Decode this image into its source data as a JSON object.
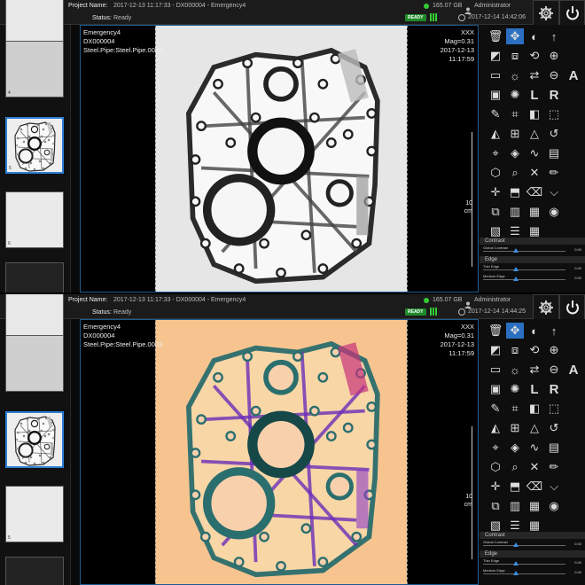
{
  "panels": [
    {
      "project_label": "Project Name:",
      "project_value": "2017-12-13 11:17:33 - DX000004 - Emergency4",
      "status_label": "Status:",
      "status_value": "Ready",
      "ready_badge": "READY",
      "disk": "165.07 GB",
      "user": "Administrator",
      "datetime": "2017-12-14 14:42:06",
      "thumb_numbers": [
        "4",
        "5",
        "6"
      ],
      "info_left": [
        "Emergency4",
        "DX000004",
        "Steel.Pipe:Steel.Pipe.0003"
      ],
      "info_right": [
        "XXX",
        "Mag=0.31",
        "2017-12-13",
        "11:17:59"
      ],
      "scale_value": "10",
      "scale_unit": "cm",
      "contrast_title": "Contrast",
      "global_contrast_label": "Global Contrast",
      "global_contrast_value": "0.00",
      "edge_title": "Edge",
      "thin_edge_label": "Thin Edge",
      "thin_edge_value": "0.00",
      "medium_edge_label": "Medium Edge",
      "medium_edge_value": "0.00",
      "palette": "grayscale"
    },
    {
      "project_label": "Project Name:",
      "project_value": "2017-12-13 11:17:33 - DX000004 - Emergency4",
      "status_label": "Status:",
      "status_value": "Ready",
      "ready_badge": "READY",
      "disk": "165.07 GB",
      "user": "Administrator",
      "datetime": "2017-12-14 14:44:25",
      "thumb_numbers": [
        "",
        "",
        "5"
      ],
      "info_left": [
        "Emergency4",
        "DX000004",
        "Steel.Pipe:Steel.Pipe.0003"
      ],
      "info_right": [
        "XXX",
        "Mag=0.31",
        "2017-12-13",
        "11:17:59"
      ],
      "scale_value": "10",
      "scale_unit": "cm",
      "contrast_title": "Contrast",
      "global_contrast_label": "Global Contrast",
      "global_contrast_value": "0.00",
      "edge_title": "Edge",
      "thin_edge_label": "Thin Edge",
      "thin_edge_value": "0.00",
      "medium_edge_label": "Medium Edge",
      "medium_edge_value": "0.00",
      "palette": "false-color"
    }
  ],
  "tools": [
    "trash-icon",
    "move-icon",
    "contrast-icon",
    "arrow-up-icon",
    "edit-curve-icon",
    "mirror-icon",
    "rotate-icon",
    "zoom-in-icon",
    "rectangle-icon",
    "brightness-icon",
    "flip-icon",
    "zoom-out-icon",
    "frame-icon",
    "sun-icon",
    "L-icon",
    "R-icon",
    "pen-icon",
    "crop-icon",
    "fill-icon",
    "rect-select-icon",
    "tone-icon",
    "grid-icon",
    "triangle-icon",
    "undo-icon",
    "label-icon",
    "emboss-icon",
    "curve-icon",
    "document-icon",
    "select-icon",
    "magnify-icon",
    "reset-icon",
    "pencil-icon",
    "crosshair-icon",
    "region-icon",
    "eraser-icon",
    "pin-icon",
    "copy-icon",
    "histogram-icon",
    "display-icon",
    "eye-icon",
    "gradient-icon",
    "list-icon",
    "table-icon"
  ],
  "tool_letters": {
    "L": "L",
    "R": "R",
    "A": "A"
  },
  "colors": {
    "accent": "#2a6fc0",
    "ready": "#1f8a2a",
    "grayscale_bg": "#e6e6e6",
    "false_color_bg": "#f7c48f"
  }
}
